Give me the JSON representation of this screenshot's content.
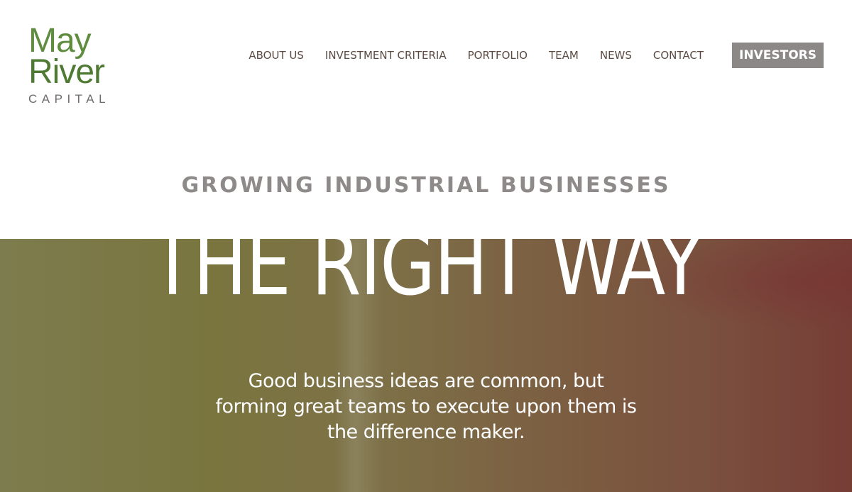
{
  "logo": {
    "line1": "May",
    "line2": "River",
    "line3": "CAPITAL"
  },
  "nav": {
    "items": [
      "ABOUT US",
      "INVESTMENT CRITERIA",
      "PORTFOLIO",
      "TEAM",
      "NEWS",
      "CONTACT"
    ],
    "investors_label": "INVESTORS"
  },
  "tagline": "GROWING INDUSTRIAL BUSINESSES",
  "hero": {
    "title": "THE RIGHT WAY",
    "text": "Good business ideas are common, but forming great teams to execute upon them is the difference maker."
  },
  "colors": {
    "logo_green": "#5f8c3f",
    "nav_text": "#5a4a42",
    "investors_bg": "#8d8888",
    "tagline_gray": "#8f8a8a"
  }
}
